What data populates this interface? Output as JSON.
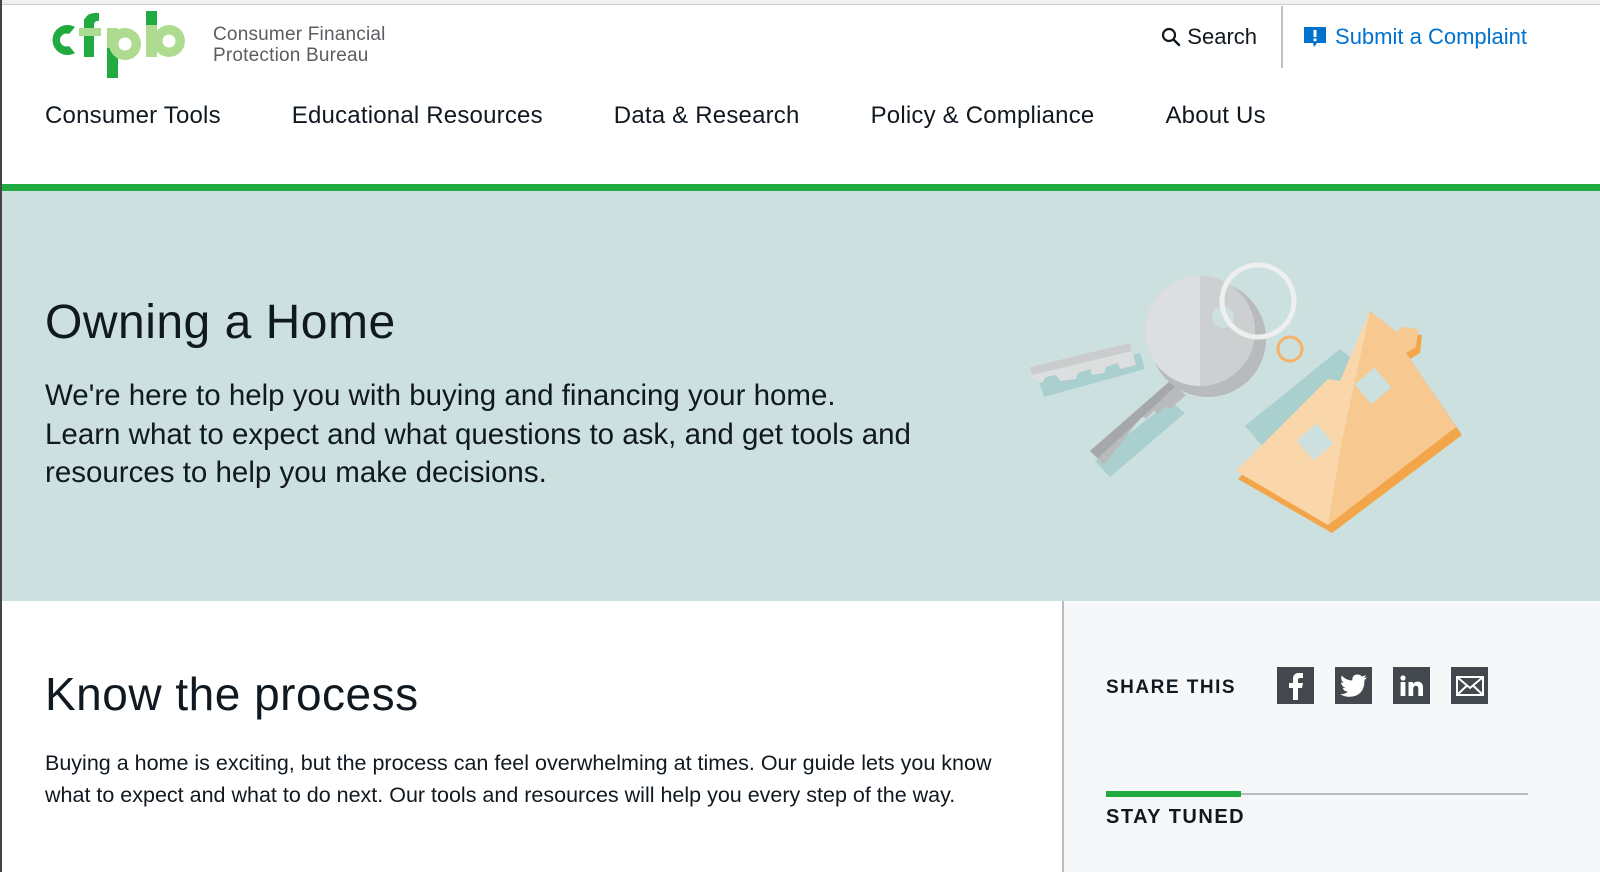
{
  "brand": {
    "logo_letters": "cfpb",
    "name_line1": "Consumer Financial",
    "name_line2": "Protection Bureau",
    "colors": {
      "green": "#20aa3f",
      "light_green": "#addc91",
      "blue": "#0072ce",
      "hero_bg": "#cce0df"
    }
  },
  "utility": {
    "search_label": "Search",
    "search_icon": "search-icon",
    "complaint_label": "Submit a Complaint",
    "complaint_icon": "complaint-icon"
  },
  "nav": {
    "items": [
      {
        "label": "Consumer Tools"
      },
      {
        "label": "Educational Resources"
      },
      {
        "label": "Data & Research"
      },
      {
        "label": "Policy & Compliance"
      },
      {
        "label": "About Us"
      }
    ]
  },
  "hero": {
    "title": "Owning a Home",
    "description": "We're here to help you with buying and financing your home. Learn what to expect and what questions to ask, and get tools and resources to help you make decisions.",
    "illustration": "keys-and-house-keychain"
  },
  "main": {
    "heading": "Know the process",
    "body": "Buying a home is exciting, but the process can feel overwhelming at times. Our guide lets you know what to expect and what to do next. Our tools and resources will help you every step of the way."
  },
  "sidebar": {
    "share_label": "SHARE THIS",
    "share_icons": [
      "facebook-icon",
      "twitter-icon",
      "linkedin-icon",
      "email-icon"
    ],
    "stay_tuned_label": "STAY TUNED"
  }
}
